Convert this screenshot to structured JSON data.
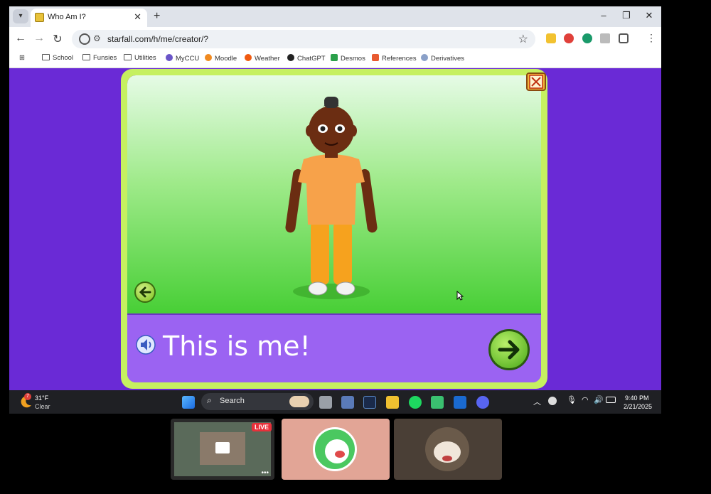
{
  "browser": {
    "tab_title": "Who Am I?",
    "url": "starfall.com/h/me/creator/?",
    "bookmarks": [
      "School",
      "Funsies",
      "Utilities",
      "MyCCU",
      "Moodle",
      "Weather",
      "ChatGPT",
      "Desmos",
      "References",
      "Derivatives"
    ]
  },
  "game": {
    "caption": "This is me!"
  },
  "taskbar": {
    "weather_temp": "31°F",
    "weather_cond": "Clear",
    "weather_badge": "7",
    "search_label": "Search",
    "time": "9:40 PM",
    "date": "2/21/2025"
  },
  "call": {
    "live_label": "LIVE"
  },
  "colors": {
    "page_bg": "#6a2ad6",
    "frame": "#c6f060",
    "caption_bar": "#9b63f2"
  }
}
